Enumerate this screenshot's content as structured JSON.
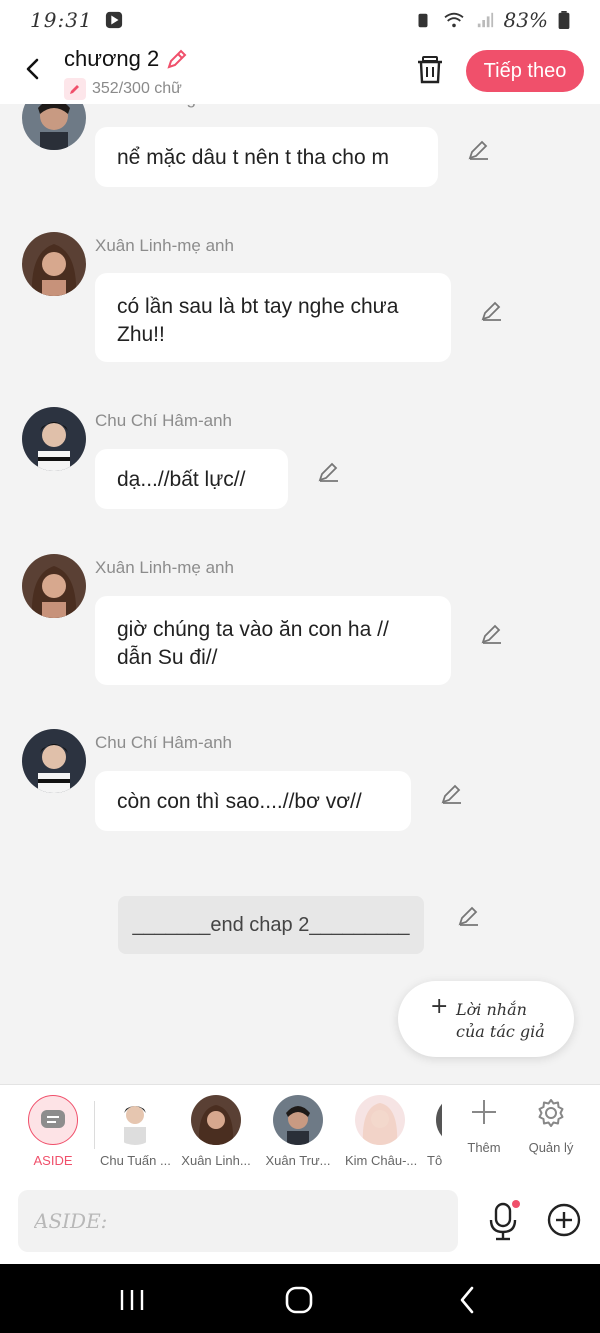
{
  "status_bar": {
    "time": "19:31",
    "battery": "83%"
  },
  "header": {
    "title": "chương 2",
    "word_count": "352/300 chữ",
    "next_button": "Tiếp theo"
  },
  "messages": [
    {
      "sender": "Xuân Trường- chi trai sca",
      "text": "nể mặc dâu t nên t tha cho m"
    },
    {
      "sender": "Xuân Linh-mẹ anh",
      "text": "có lần sau là bt tay nghe chưa Zhu!!"
    },
    {
      "sender": "Chu Chí Hâm-anh",
      "text": "dạ...//bất lực//"
    },
    {
      "sender": "Xuân Linh-mẹ anh",
      "text": "giờ chúng ta vào ăn con ha // dẫn Su đi//"
    },
    {
      "sender": "Chu Chí Hâm-anh",
      "text": "còn con thì sao....//bơ vơ//"
    }
  ],
  "end_note": "_______end chap 2_________",
  "author_note": {
    "line1": "Lời nhắn",
    "line2": "của tác giả"
  },
  "characters": [
    {
      "name": "ASIDE"
    },
    {
      "name": "Chu Tuấn ..."
    },
    {
      "name": "Xuân Linh..."
    },
    {
      "name": "Xuân Trư..."
    },
    {
      "name": "Kim Châu-..."
    },
    {
      "name": "Tô"
    }
  ],
  "tools": {
    "add_label": "Thêm",
    "manage_label": "Quản lý"
  },
  "input": {
    "placeholder": "ASIDE:"
  },
  "colors": {
    "accent": "#f0506b",
    "background": "#f3f3f3"
  }
}
